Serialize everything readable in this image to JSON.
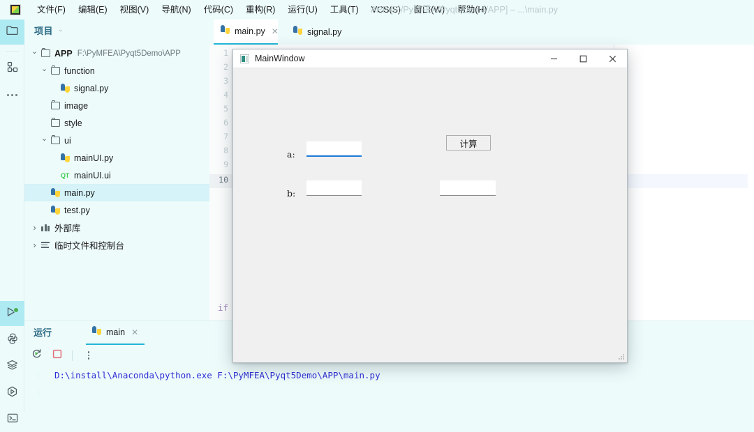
{
  "window": {
    "title": "APP [F:/PyMFEA/Pyqt5Demo/APP] – ...\\main.py",
    "logo_icon": "pycharm-logo-icon"
  },
  "menubar": {
    "items": [
      {
        "label": "文件(F)",
        "name": "menu-file"
      },
      {
        "label": "编辑(E)",
        "name": "menu-edit"
      },
      {
        "label": "视图(V)",
        "name": "menu-view"
      },
      {
        "label": "导航(N)",
        "name": "menu-navigate"
      },
      {
        "label": "代码(C)",
        "name": "menu-code"
      },
      {
        "label": "重构(R)",
        "name": "menu-refactor"
      },
      {
        "label": "运行(U)",
        "name": "menu-run"
      },
      {
        "label": "工具(T)",
        "name": "menu-tools"
      },
      {
        "label": "VCS(S)",
        "name": "menu-vcs"
      },
      {
        "label": "窗口(W)",
        "name": "menu-window"
      },
      {
        "label": "帮助(H)",
        "name": "menu-help"
      }
    ]
  },
  "rail": {
    "top": [
      {
        "icon": "folder-icon",
        "name": "rail-project",
        "active": true
      },
      {
        "icon": "structure-icon",
        "name": "rail-structure",
        "active": false
      },
      {
        "icon": "more-icon",
        "name": "rail-more",
        "active": false
      }
    ],
    "bottom": [
      {
        "icon": "run-icon",
        "name": "rail-run",
        "active": true
      },
      {
        "icon": "python-console-icon",
        "name": "rail-python-console",
        "active": false
      },
      {
        "icon": "layers-icon",
        "name": "rail-services",
        "active": false
      },
      {
        "icon": "play-hex-icon",
        "name": "rail-debug",
        "active": false
      },
      {
        "icon": "terminal-icon",
        "name": "rail-terminal",
        "active": false
      }
    ]
  },
  "project": {
    "header": "项目",
    "chevron": "chevron-down-icon",
    "tree": [
      {
        "label": "APP",
        "sub": "F:\\PyMFEA\\Pyqt5Demo\\APP",
        "icon": "folder-icon",
        "indent": 0,
        "arrow": "open",
        "bold": true,
        "selected": false
      },
      {
        "label": "function",
        "sub": "",
        "icon": "folder-icon",
        "indent": 1,
        "arrow": "open",
        "bold": false,
        "selected": false
      },
      {
        "label": "signal.py",
        "sub": "",
        "icon": "python-file-icon",
        "indent": 2,
        "arrow": "none",
        "bold": false,
        "selected": false
      },
      {
        "label": "image",
        "sub": "",
        "icon": "folder-icon",
        "indent": 1,
        "arrow": "none",
        "bold": false,
        "selected": false
      },
      {
        "label": "style",
        "sub": "",
        "icon": "folder-icon",
        "indent": 1,
        "arrow": "none",
        "bold": false,
        "selected": false
      },
      {
        "label": "ui",
        "sub": "",
        "icon": "folder-icon",
        "indent": 1,
        "arrow": "open",
        "bold": false,
        "selected": false
      },
      {
        "label": "mainUI.py",
        "sub": "",
        "icon": "python-file-icon",
        "indent": 2,
        "arrow": "none",
        "bold": false,
        "selected": false
      },
      {
        "label": "mainUI.ui",
        "sub": "",
        "icon": "qt-file-icon",
        "indent": 2,
        "arrow": "none",
        "bold": false,
        "selected": false
      },
      {
        "label": "main.py",
        "sub": "",
        "icon": "python-file-icon",
        "indent": 1,
        "arrow": "none",
        "bold": false,
        "selected": true
      },
      {
        "label": "test.py",
        "sub": "",
        "icon": "python-file-icon",
        "indent": 1,
        "arrow": "none",
        "bold": false,
        "selected": false
      },
      {
        "label": "外部库",
        "sub": "",
        "icon": "library-icon",
        "indent": 0,
        "arrow": "closed",
        "bold": false,
        "selected": false
      },
      {
        "label": "临时文件和控制台",
        "sub": "",
        "icon": "scratches-icon",
        "indent": 0,
        "arrow": "closed",
        "bold": false,
        "selected": false
      }
    ]
  },
  "editor": {
    "tabs": [
      {
        "label": "main.py",
        "icon": "python-file-icon",
        "active": true,
        "closable": true,
        "close_icon": "close-icon"
      },
      {
        "label": "signal.py",
        "icon": "python-file-icon",
        "active": false,
        "closable": false,
        "close_icon": ""
      }
    ],
    "line_numbers": [
      "1",
      "2",
      "3",
      "4",
      "5",
      "6",
      "7",
      "8",
      "9",
      "10"
    ],
    "current_line": "10",
    "code_fragment": "if"
  },
  "run_panel": {
    "label": "运行",
    "tab": {
      "label": "main",
      "icon": "python-file-icon",
      "close_icon": "close-icon"
    },
    "toolbar": [
      {
        "icon": "rerun-icon",
        "name": "rerun-button"
      },
      {
        "icon": "stop-icon",
        "name": "stop-button"
      },
      {
        "icon": "more-vertical-icon",
        "name": "more-options-button"
      }
    ],
    "nav": [
      {
        "icon": "arrow-up-icon",
        "name": "previous-occurrence-button"
      },
      {
        "icon": "arrow-down-icon",
        "name": "next-occurrence-button"
      }
    ],
    "console_output": "D:\\install\\Anaconda\\python.exe F:\\PyMFEA\\Pyqt5Demo\\APP\\main.py"
  },
  "dialog": {
    "title": "MainWindow",
    "icon": "app-window-icon",
    "buttons": [
      {
        "glyph": "—",
        "name": "minimize-button"
      },
      {
        "glyph": "☐",
        "name": "maximize-button"
      },
      {
        "glyph": "✕",
        "name": "close-button"
      }
    ],
    "fields": [
      {
        "label": "a:",
        "value": "",
        "name": "input-a",
        "focused": true
      },
      {
        "label": "b:",
        "value": "",
        "name": "input-b",
        "focused": false
      }
    ],
    "calc_button": "计算",
    "result_value": "",
    "resize_grip": "resize-grip-icon"
  },
  "colors": {
    "accent": "#23b6d6",
    "panel_bg": "#edfbfb",
    "selection": "#d5f3f8",
    "rail_active": "#aeeaf2",
    "console_text": "#2d2dd4",
    "dialog_bg": "#f0f0f0",
    "focus_underline": "#1e7ad6"
  }
}
